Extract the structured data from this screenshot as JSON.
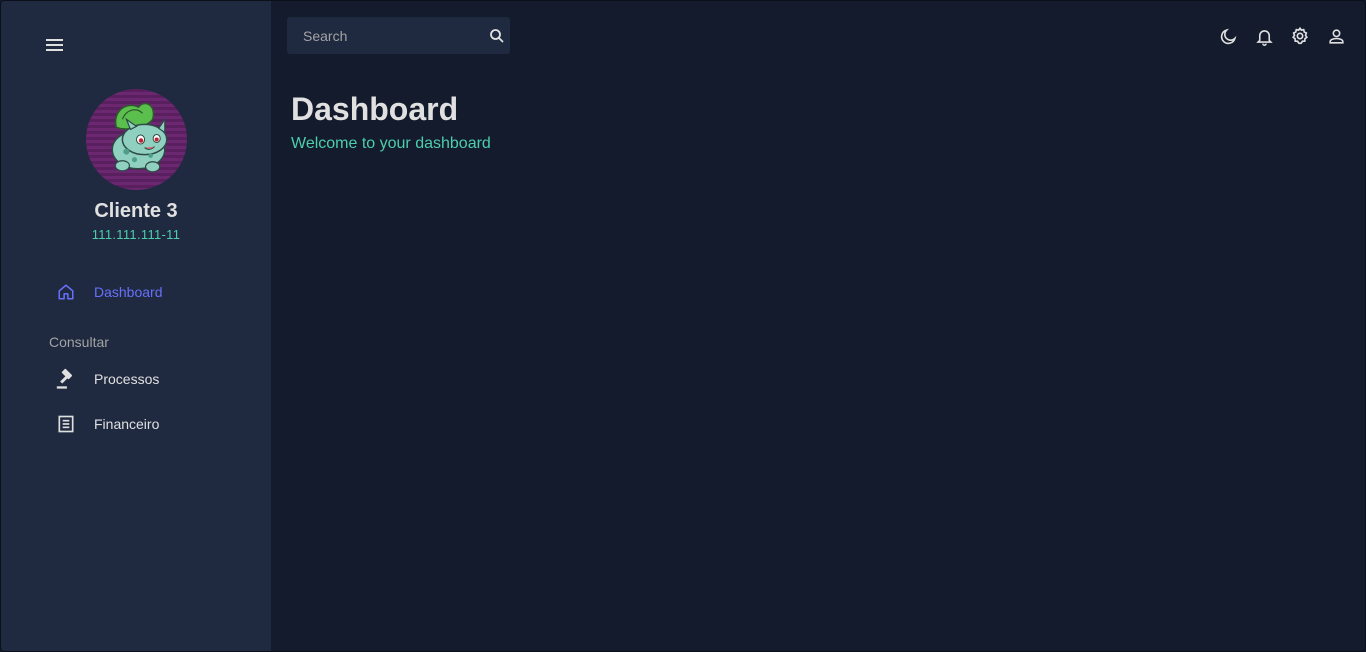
{
  "sidebar": {
    "user": {
      "name": "Cliente 3",
      "id": "111.111.111-11"
    },
    "items": [
      {
        "label": "Dashboard",
        "icon": "home-icon",
        "active": true
      },
      {
        "label": "Processos",
        "icon": "gavel-icon"
      },
      {
        "label": "Financeiro",
        "icon": "receipt-icon"
      }
    ],
    "section_label": "Consultar"
  },
  "search": {
    "placeholder": "Search"
  },
  "topbar": {
    "icons": [
      "moon-icon",
      "bell-icon",
      "gear-icon",
      "user-icon"
    ]
  },
  "main": {
    "title": "Dashboard",
    "subtitle": "Welcome to your dashboard"
  },
  "colors": {
    "background": "#141b2d",
    "sidebar": "#1f2a40",
    "accent": "#6870fa",
    "secondary": "#4cceac"
  }
}
